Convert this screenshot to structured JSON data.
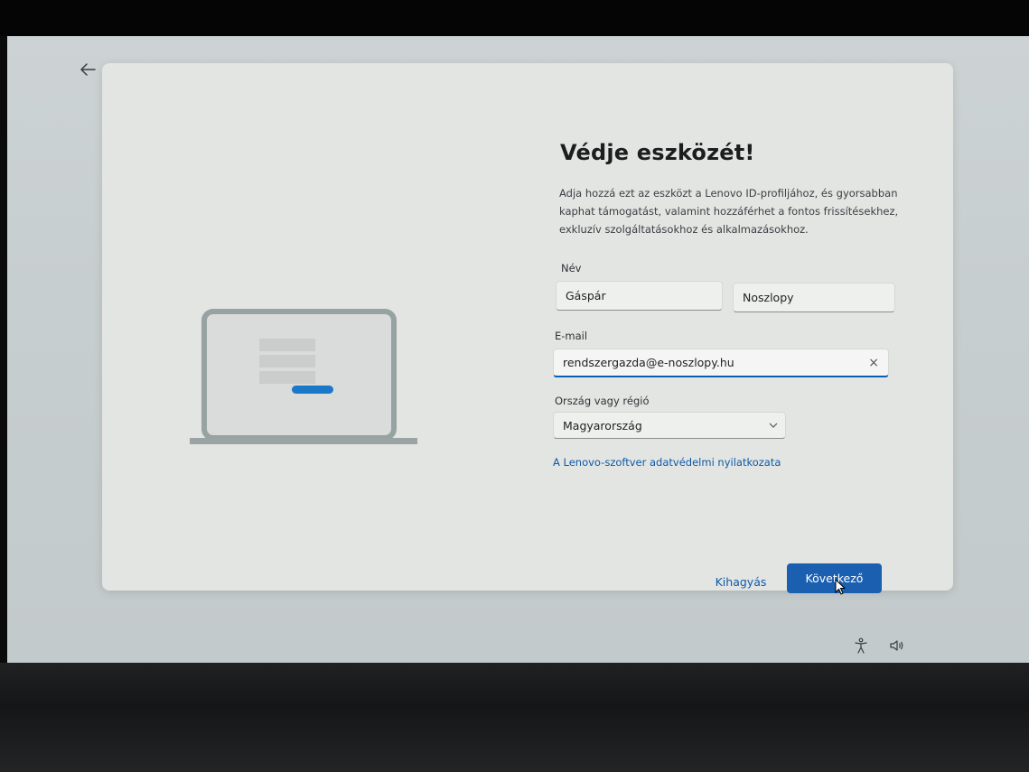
{
  "dialog": {
    "title": "Védje eszközét!",
    "description": "Adja hozzá ezt az eszközt a Lenovo ID-profiljához, és gyorsabban kaphat támogatást, valamint hozzáférhet a fontos frissítésekhez, exkluzív szolgáltatásokhoz és alkalmazásokhoz.",
    "name_label": "Név",
    "first_name_value": "Gáspár",
    "last_name_value": "Noszlopy",
    "email_label": "E-mail",
    "email_value": "rendszergazda@e-noszlopy.hu",
    "clear_icon": "×",
    "country_label": "Ország vagy régió",
    "country_value": "Magyarország",
    "privacy_link": "A Lenovo-szoftver adatvédelmi nyilatkozata",
    "skip_label": "Kihagyás",
    "next_label": "Következő"
  },
  "icons": {
    "back": "back-arrow-icon",
    "clear": "close-icon",
    "dropdown": "chevron-down-icon",
    "accessibility": "accessibility-icon",
    "volume": "volume-icon"
  },
  "colors": {
    "accent": "#1a5fb0",
    "link": "#0e5aa7",
    "dialog_bg": "#e3e5e3"
  }
}
